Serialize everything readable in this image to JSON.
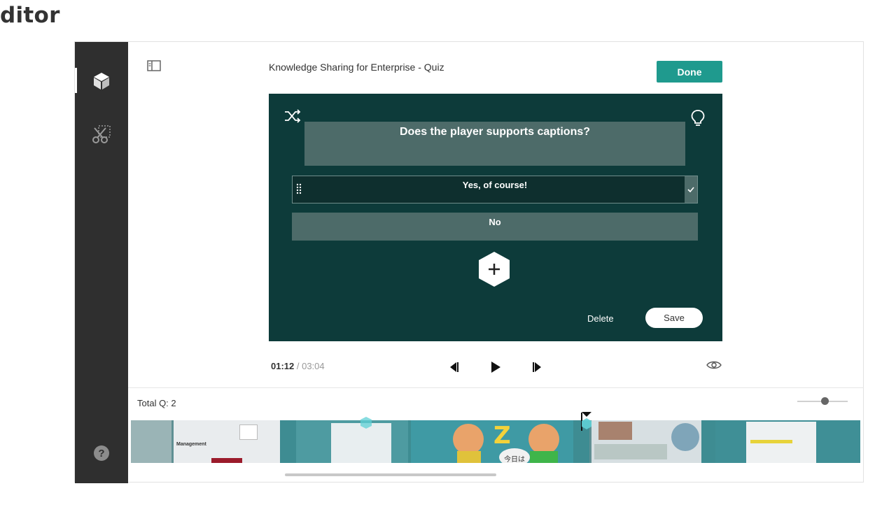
{
  "page": {
    "heading": "ditor"
  },
  "editor": {
    "title": "Knowledge Sharing for Enterprise - Quiz",
    "done_label": "Done"
  },
  "sidebar": {
    "items": [
      {
        "icon": "cube-icon",
        "active": true
      },
      {
        "icon": "scissors-icon",
        "active": false
      }
    ],
    "help_label": "?"
  },
  "question": {
    "text": "Does the player supports captions?",
    "answers": [
      {
        "text": "Yes, of course!",
        "correct": true
      },
      {
        "text": "No",
        "correct": false
      }
    ],
    "delete_label": "Delete",
    "save_label": "Save"
  },
  "player": {
    "current_time": "01:12",
    "separator": " / ",
    "total_time": "03:04"
  },
  "timeline": {
    "total_questions_label": "Total Q: 2",
    "thumbnail_texts": [
      "Management",
      "今日は"
    ]
  },
  "colors": {
    "accent": "#1f9a8e",
    "stage": "#0d3b3a",
    "sidebar": "#2f2f2f"
  }
}
